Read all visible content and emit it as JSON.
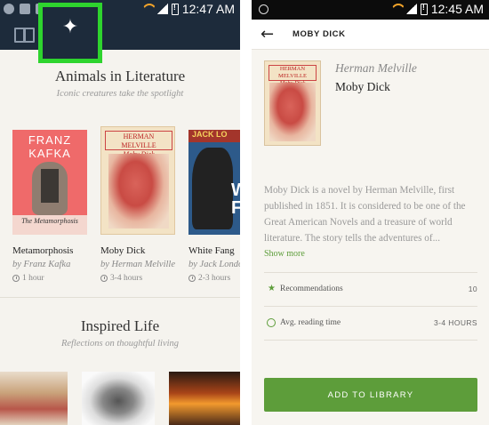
{
  "left": {
    "status_time": "12:47 AM",
    "sections": [
      {
        "title": "Animals in Literature",
        "subtitle": "Iconic creatures take the spotlight",
        "books": [
          {
            "title": "Metamorphosis",
            "by": "by",
            "author": "Franz Kafka",
            "time": "1 hour",
            "cover_text_top": "FRANZ KAFKA",
            "cover_text_bottom": "The Metamorphosis"
          },
          {
            "title": "Moby Dick",
            "by": "by",
            "author": "Herman Melville",
            "time": "3-4 hours",
            "cover_text_top": "HERMAN MELVILLE",
            "cover_text_bottom": "Moby Dick"
          },
          {
            "title": "White Fang",
            "by": "by",
            "author": "Jack London",
            "time": "2-3 hours",
            "cover_text_top": "JACK LO",
            "cover_text_bottom": "WH FA"
          }
        ]
      },
      {
        "title": "Inspired Life",
        "subtitle": "Reflections on thoughtful living"
      }
    ]
  },
  "right": {
    "status_time": "12:45 AM",
    "header_title": "MOBY DICK",
    "author": "Herman Melville",
    "title": "Moby Dick",
    "cover_text_top": "HERMAN MELVILLE",
    "cover_text_bottom": "Moby Dick",
    "description": "Moby Dick is a novel by Herman Melville, first published in 1851. It is considered to be one of the Great American Novels and a treasure of world literature. The story tells the adventures of...",
    "show_more": "Show more",
    "stats": [
      {
        "label": "Recommendations",
        "value": "10",
        "icon": "star-icon"
      },
      {
        "label": "Avg. reading time",
        "value": "3-4 HOURS",
        "icon": "clock-icon"
      }
    ],
    "add_button": "ADD TO LIBRARY"
  },
  "colors": {
    "nav": "#1d2b3b",
    "highlight": "#2ed42e",
    "accent": "#5d9d3a"
  }
}
